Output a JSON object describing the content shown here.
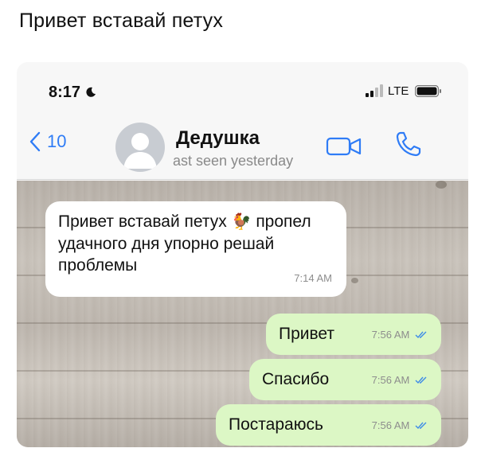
{
  "post": {
    "caption": "Привет вставай петух"
  },
  "status_bar": {
    "time": "8:17",
    "network": "LTE"
  },
  "chat_header": {
    "back_count": "10",
    "contact_name": "Дедушка",
    "last_seen": "ast seen yesterday",
    "accent_color": "#2f7cf6"
  },
  "messages": [
    {
      "direction": "incoming",
      "text": "Привет вставай петух",
      "emoji": "🐓",
      "text2": "пропел удачного дня упорно решай проблемы",
      "time": "7:14 AM"
    },
    {
      "direction": "outgoing",
      "text": "Привет",
      "time": "7:56 AM",
      "status": "read"
    },
    {
      "direction": "outgoing",
      "text": "Спасибо",
      "time": "7:56 AM",
      "status": "read"
    },
    {
      "direction": "outgoing",
      "text": "Постараюсь",
      "time": "7:56 AM",
      "status": "read"
    }
  ],
  "colors": {
    "incoming_bubble": "#ffffff",
    "outgoing_bubble": "#dcf7c5",
    "read_ticks": "#3d8be8"
  }
}
